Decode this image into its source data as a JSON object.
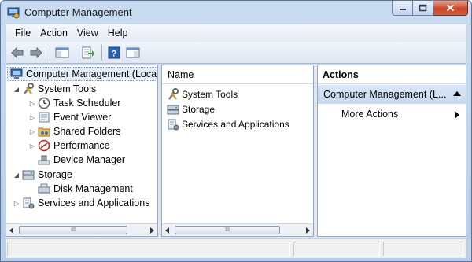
{
  "window": {
    "title": "Computer Management"
  },
  "menu": [
    "File",
    "Action",
    "View",
    "Help"
  ],
  "tree": {
    "root": "Computer Management (Local",
    "items": [
      {
        "label": "System Tools",
        "icon": "tools-icon",
        "level": 1,
        "expander": "expanded"
      },
      {
        "label": "Task Scheduler",
        "icon": "clock-icon",
        "level": 2,
        "expander": "collapsed"
      },
      {
        "label": "Event Viewer",
        "icon": "event-viewer-icon",
        "level": 2,
        "expander": "collapsed"
      },
      {
        "label": "Shared Folders",
        "icon": "shared-folders-icon",
        "level": 2,
        "expander": "collapsed"
      },
      {
        "label": "Performance",
        "icon": "performance-icon",
        "level": 2,
        "expander": "collapsed"
      },
      {
        "label": "Device Manager",
        "icon": "device-manager-icon",
        "level": 2,
        "expander": "none"
      },
      {
        "label": "Storage",
        "icon": "storage-icon",
        "level": 1,
        "expander": "expanded"
      },
      {
        "label": "Disk Management",
        "icon": "disk-icon",
        "level": 2,
        "expander": "none"
      },
      {
        "label": "Services and Applications",
        "icon": "services-icon",
        "level": 1,
        "expander": "collapsed"
      }
    ]
  },
  "list": {
    "header": "Name",
    "items": [
      {
        "label": "System Tools",
        "icon": "tools-icon"
      },
      {
        "label": "Storage",
        "icon": "storage-icon"
      },
      {
        "label": "Services and Applications",
        "icon": "services-icon"
      }
    ]
  },
  "actions": {
    "header": "Actions",
    "section": "Computer Management (L...",
    "more": "More Actions"
  },
  "scroll": {
    "thumb_grip": "III"
  },
  "colors": {
    "selection": "#e3eefb",
    "section_bg": "#c7d9f0",
    "close_button": "#c9452a"
  }
}
